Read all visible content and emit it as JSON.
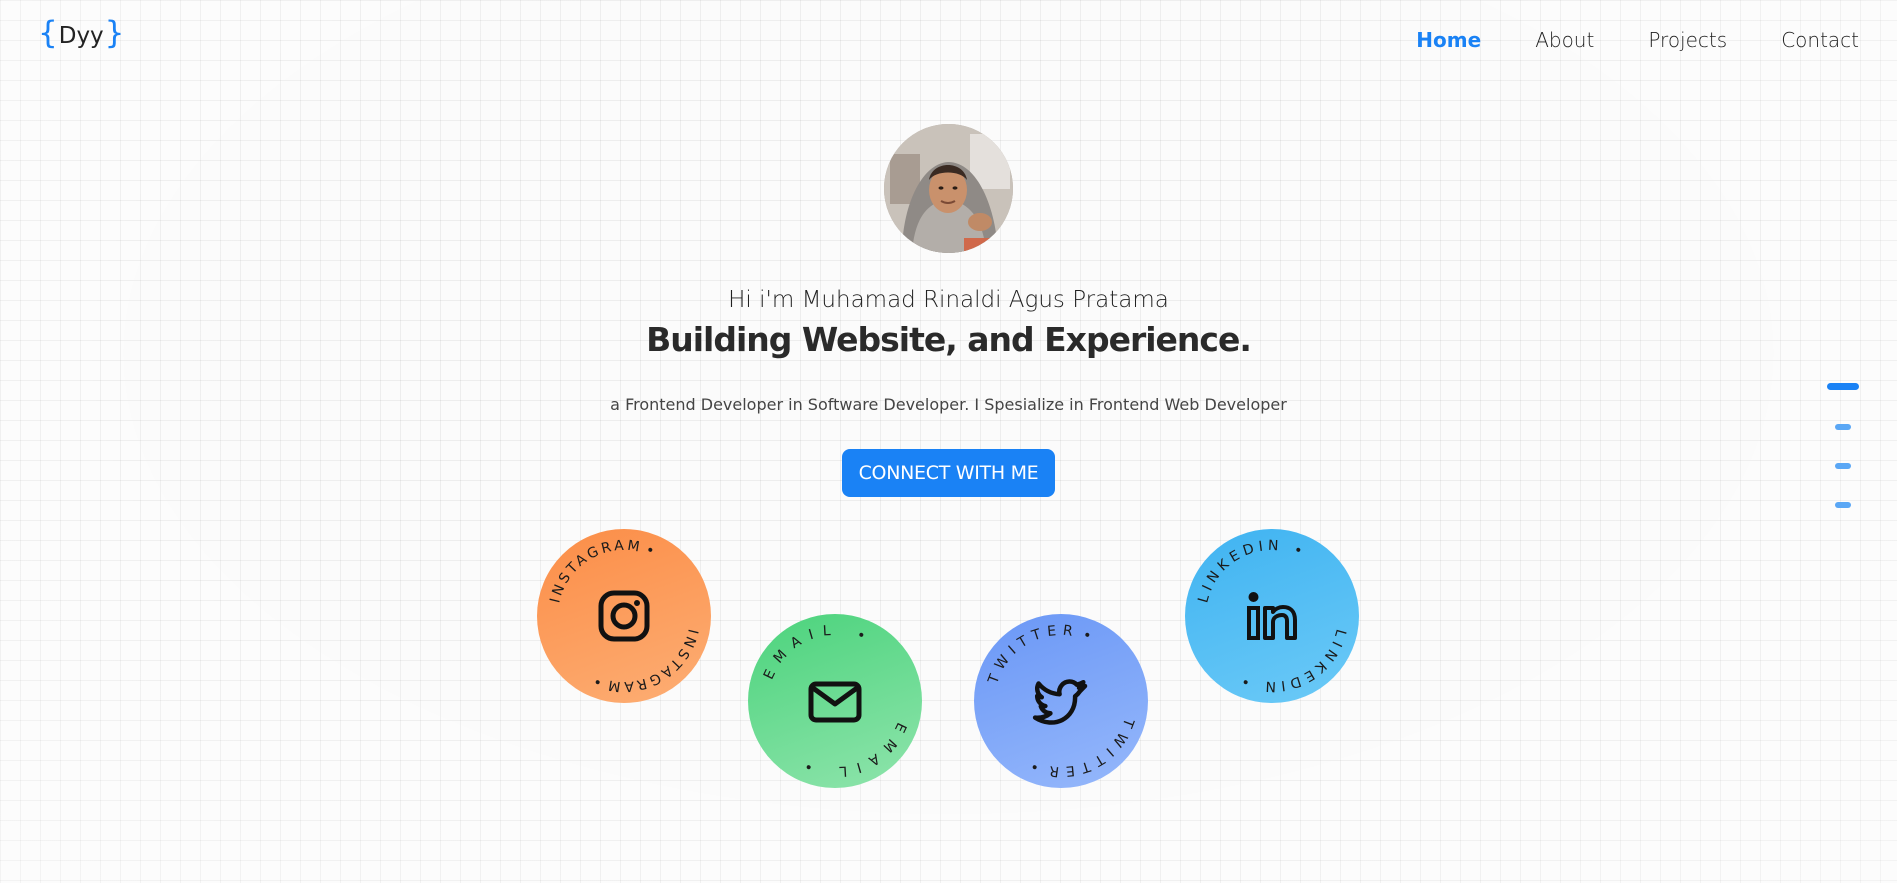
{
  "header": {
    "logo": {
      "open": "{",
      "text": "Dyy",
      "close": "}"
    },
    "nav": [
      {
        "label": "Home",
        "active": true
      },
      {
        "label": "About",
        "active": false
      },
      {
        "label": "Projects",
        "active": false
      },
      {
        "label": "Contact",
        "active": false
      }
    ]
  },
  "hero": {
    "avatar_icon": "profile-photo",
    "intro": "Hi i'm Muhamad Rinaldi Agus Pratama",
    "headline": "Building Website, and Experience.",
    "tagline": "a Frontend Developer in Software Developer. I Spesialize in Frontend Web Developer",
    "cta_label": "CONNECT WITH ME"
  },
  "social": [
    {
      "label": "INSTAGRAM",
      "icon": "instagram-icon",
      "color": "#fb8d47"
    },
    {
      "label": "EMAIL",
      "icon": "mail-icon",
      "color": "#4bd37c"
    },
    {
      "label": "TWITTER",
      "icon": "twitter-icon",
      "color": "#6a97f6"
    },
    {
      "label": "LINKEDIN",
      "icon": "linkedin-icon",
      "color": "#3fb3f1"
    }
  ],
  "slider": {
    "count": 4,
    "active_index": 0
  },
  "colors": {
    "accent": "#1a82f5",
    "text": "#222222",
    "background": "#fbfbfb"
  }
}
